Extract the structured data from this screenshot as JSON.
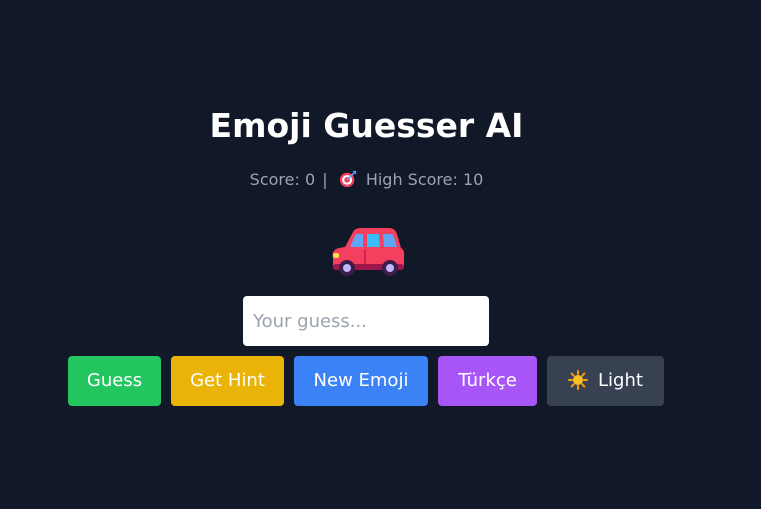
{
  "header": {
    "title": "Emoji Guesser AI"
  },
  "score": {
    "score_text": "Score: 0",
    "separator": "|",
    "high_score_text": "High Score: 10"
  },
  "emoji": {
    "icon": "car-emoji"
  },
  "guess": {
    "placeholder": "Your guess...",
    "value": ""
  },
  "buttons": {
    "guess_label": "Guess",
    "hint_label": "Get Hint",
    "new_emoji_label": "New Emoji",
    "language_label": "Türkçe",
    "theme_label": "Light"
  },
  "colors": {
    "background": "#111827",
    "guess": "#22c55e",
    "hint": "#eab308",
    "new_emoji": "#3b82f6",
    "language": "#a855f7",
    "theme": "#374151"
  }
}
